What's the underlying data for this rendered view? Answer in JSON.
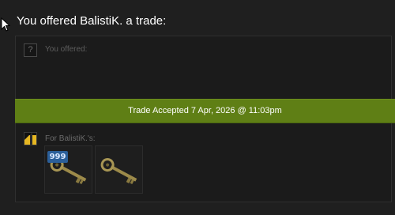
{
  "trade": {
    "heading": "You offered BalistiK. a trade:",
    "you_offered_label": "You offered:",
    "unknown_avatar_glyph": "?",
    "status_banner": "Trade Accepted 7 Apr, 2026 @ 11:03pm",
    "for_user_label": "For BalistiK.'s:",
    "items": [
      {
        "name": "key",
        "quantity": "999"
      },
      {
        "name": "key",
        "quantity": null
      }
    ]
  },
  "colors": {
    "banner": "#5f7f15",
    "quantity_badge": "#2b5f99",
    "background": "#1f1f1f"
  }
}
